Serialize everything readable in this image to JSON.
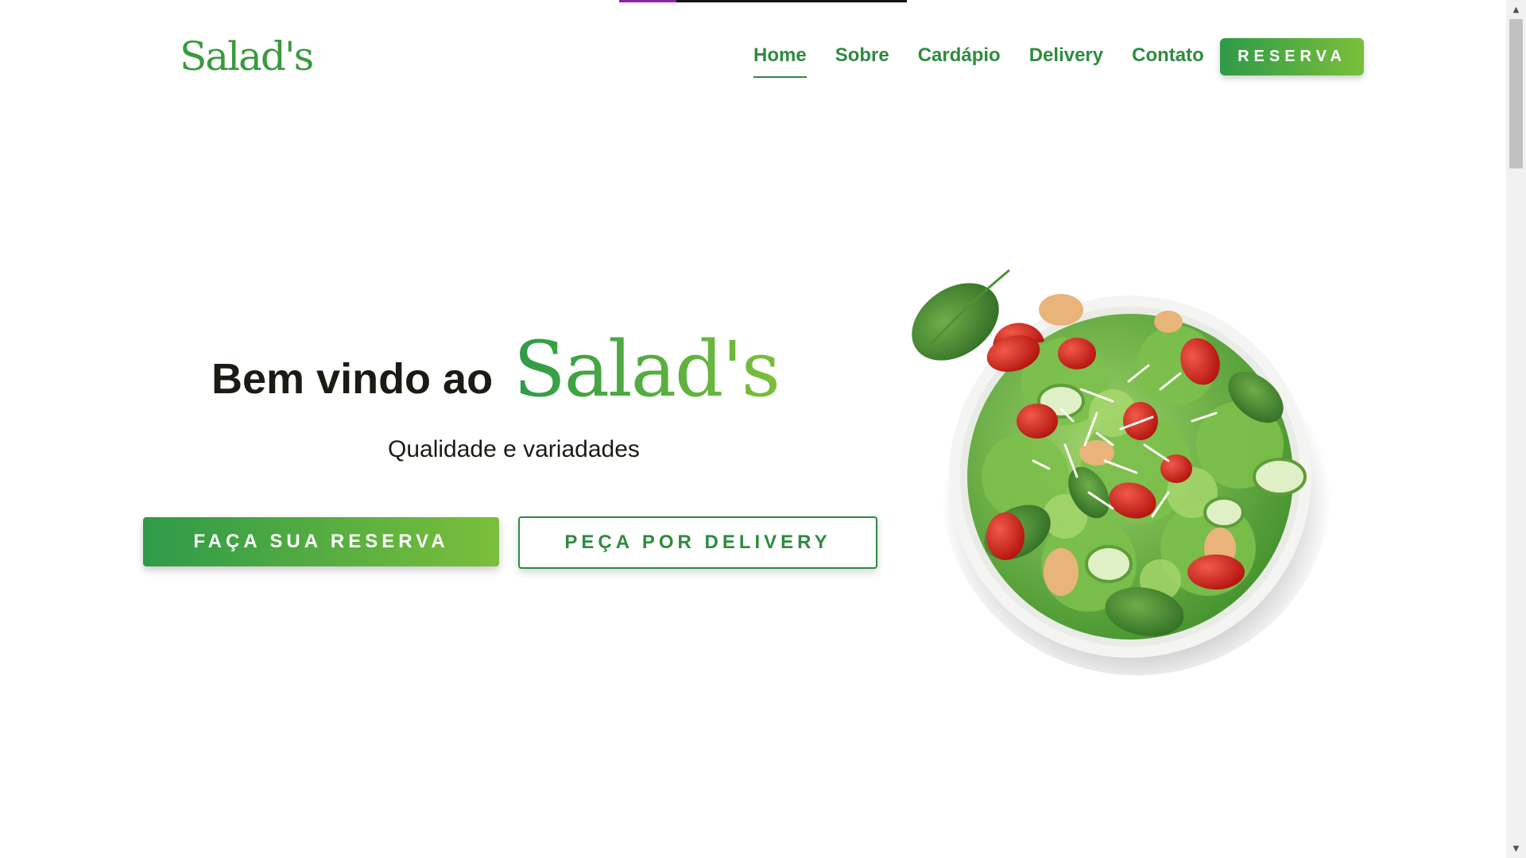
{
  "brand": {
    "logo_text": "Salad's",
    "primary_color": "#2e8b3e",
    "gradient_start": "#2e9a48",
    "gradient_end": "#7bbf3a"
  },
  "nav": {
    "items": [
      {
        "label": "Home",
        "active": true
      },
      {
        "label": "Sobre",
        "active": false
      },
      {
        "label": "Cardápio",
        "active": false
      },
      {
        "label": "Delivery",
        "active": false
      },
      {
        "label": "Contato",
        "active": false
      }
    ],
    "cta_label": "RESERVA"
  },
  "hero": {
    "welcome": "Bem vindo ao",
    "brand": "Salad's",
    "tagline": "Qualidade e variadades",
    "primary_button": "FAÇA SUA RESERVA",
    "secondary_button": "PEÇA POR DELIVERY"
  },
  "icons": {
    "scroll_up": "triangle-up-icon",
    "scroll_down": "triangle-down-icon"
  }
}
